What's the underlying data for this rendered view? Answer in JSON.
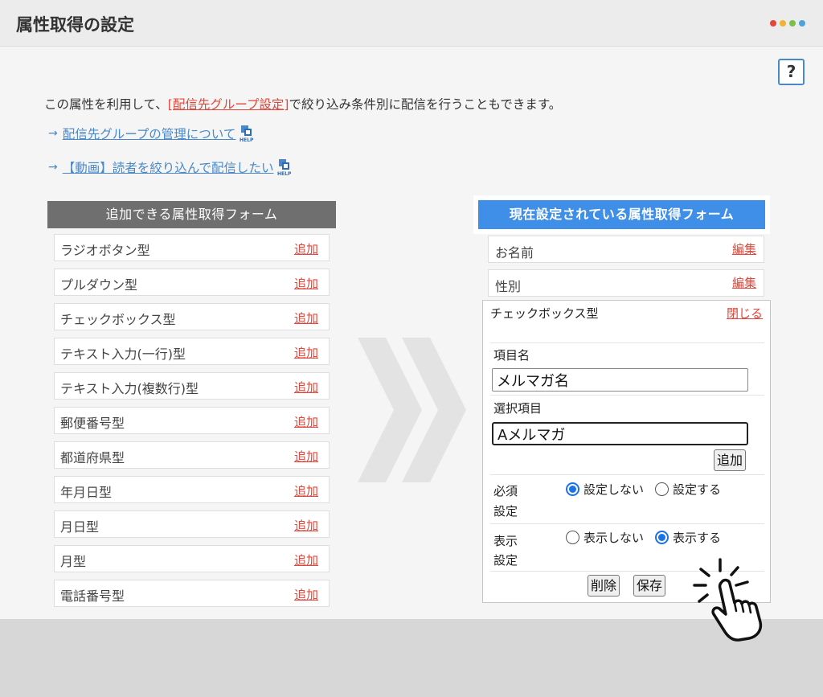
{
  "page": {
    "title": "属性取得の設定",
    "dot_colors": [
      "#e1473b",
      "#f2b233",
      "#7cbf4a",
      "#4ba3d9"
    ]
  },
  "help_button": {
    "label": "?"
  },
  "intro": {
    "before": "この属性を利用して、",
    "link": "[配信先グループ設定]",
    "after": "で絞り込み条件別に配信を行うこともできます。"
  },
  "help_links": [
    {
      "arrow": "→",
      "label": "配信先グループの管理について"
    },
    {
      "arrow": "→",
      "label": "【動画】読者を絞り込んで配信したい"
    }
  ],
  "left_panel": {
    "header": "追加できる属性取得フォーム",
    "add_label": "追加",
    "items": [
      "ラジオボタン型",
      "プルダウン型",
      "チェックボックス型",
      "テキスト入力(一行)型",
      "テキスト入力(複数行)型",
      "郵便番号型",
      "都道府県型",
      "年月日型",
      "月日型",
      "月型",
      "電話番号型"
    ]
  },
  "right_panel": {
    "header": "現在設定されている属性取得フォーム",
    "edit_label": "編集",
    "items": [
      "お名前",
      "性別"
    ]
  },
  "form": {
    "title": "チェックボックス型",
    "close_label": "閉じる",
    "item_name_label": "項目名",
    "item_name_value": "メルマガ名",
    "choices_label": "選択項目",
    "choice_value": "Aメルマガ",
    "add_button": "追加",
    "required_label_1": "必須",
    "required_label_2": "設定",
    "required_options": [
      "設定しない",
      "設定する"
    ],
    "required_selected": "設定しない",
    "display_label_1": "表示",
    "display_label_2": "設定",
    "display_options": [
      "表示しない",
      "表示する"
    ],
    "display_selected": "表示する",
    "delete_button": "削除",
    "save_button": "保存"
  }
}
